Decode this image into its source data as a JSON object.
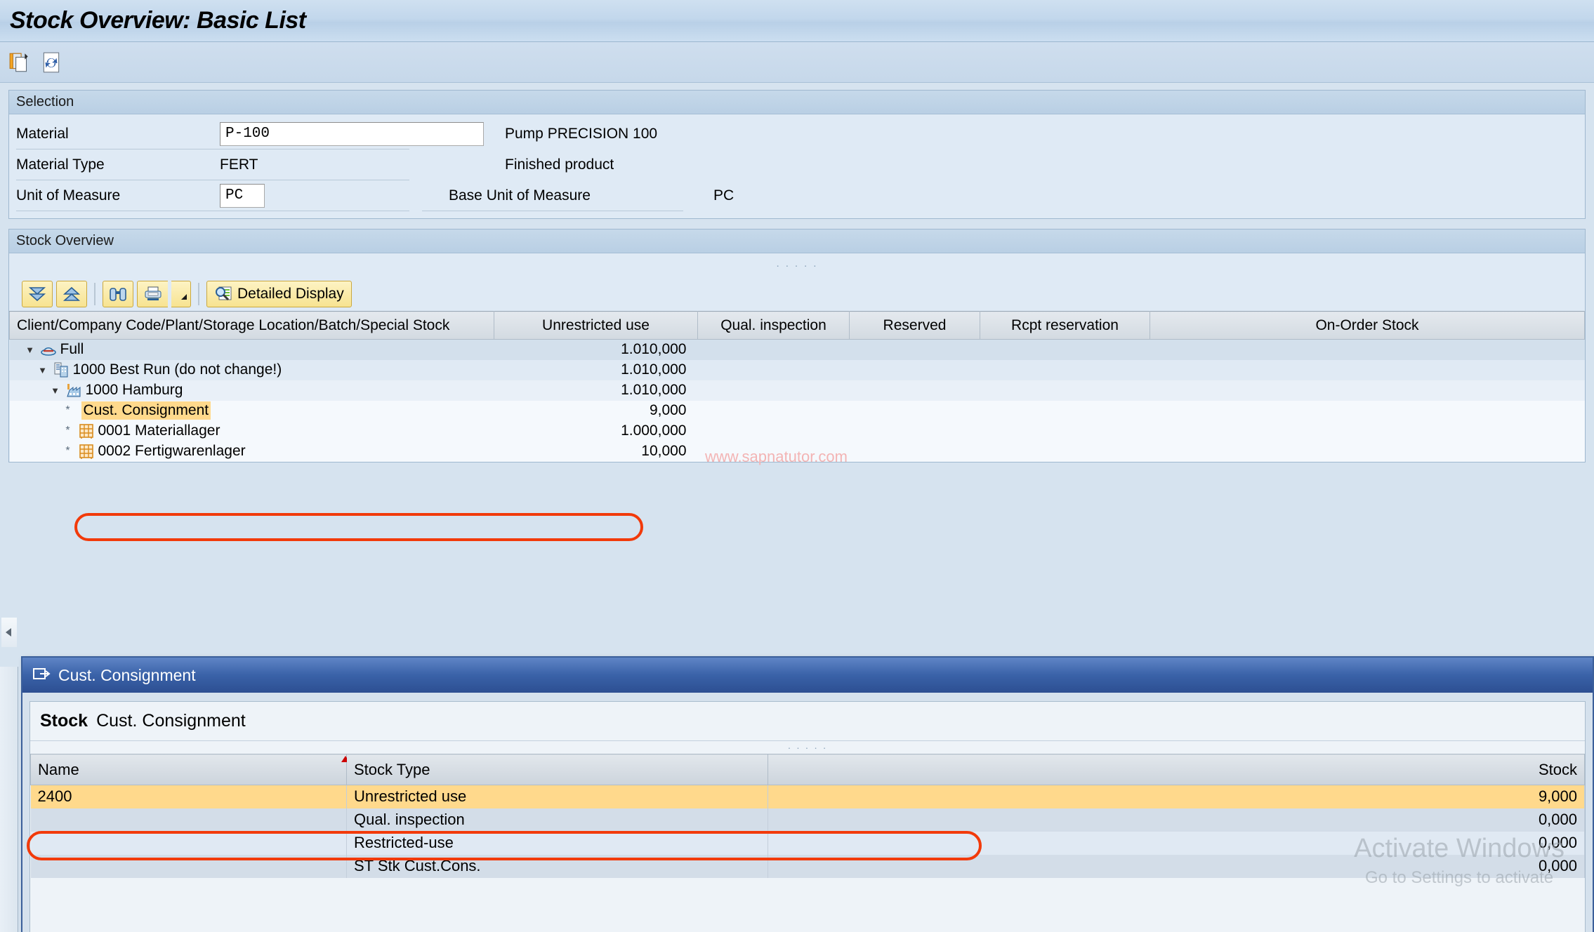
{
  "window": {
    "title": "Stock Overview: Basic List"
  },
  "main_toolbar": {
    "items": [
      {
        "name": "copy-icon",
        "tooltip": "Copy"
      },
      {
        "name": "refresh-icon",
        "tooltip": "Refresh"
      }
    ]
  },
  "selection": {
    "header": "Selection",
    "material_label": "Material",
    "material_value": "P-100",
    "material_desc": "Pump PRECISION 100",
    "material_type_label": "Material Type",
    "material_type_value": "FERT",
    "material_type_desc": "Finished product",
    "unit_label": "Unit of Measure",
    "unit_value": "PC",
    "base_unit_label": "Base Unit of Measure",
    "base_unit_value": "PC"
  },
  "stock_overview": {
    "header": "Stock Overview",
    "grip": "· · · · ·",
    "toolbar": {
      "expand_all": "expand-all-icon",
      "collapse_all": "collapse-all-icon",
      "find": "find-icon",
      "print": "print-icon",
      "print_menu": "chevron-down-icon",
      "detailed_display_label": "Detailed Display",
      "detailed_display_icon": "magnifier-list-icon"
    },
    "columns": [
      "Client/Company Code/Plant/Storage Location/Batch/Special Stock",
      "Unrestricted use",
      "Qual. inspection",
      "Reserved",
      "Rcpt reservation",
      "On-Order Stock"
    ],
    "watermark": "www.sapnatutor.com",
    "rows": [
      {
        "level": 0,
        "expander": "expanded",
        "icon": "client-hat-icon",
        "label": "Full",
        "unrestricted": "1.010,000",
        "highlight": false
      },
      {
        "level": 1,
        "expander": "expanded",
        "icon": "company-code-icon",
        "label": "1000 Best Run (do not change!)",
        "unrestricted": "1.010,000",
        "highlight": false
      },
      {
        "level": 2,
        "expander": "expanded",
        "icon": "plant-icon",
        "label": "1000 Hamburg",
        "unrestricted": "1.010,000",
        "highlight": false
      },
      {
        "level": 3,
        "expander": "leaf",
        "icon": "none",
        "label": "Cust. Consignment",
        "unrestricted": "9,000",
        "highlight": true
      },
      {
        "level": 3,
        "expander": "leaf",
        "icon": "storage-loc-icon",
        "label": "0001 Materiallager",
        "unrestricted": "1.000,000",
        "highlight": false
      },
      {
        "level": 3,
        "expander": "leaf",
        "icon": "storage-loc-icon",
        "label": "0002 Fertigwarenlager",
        "unrestricted": "10,000",
        "highlight": false
      }
    ]
  },
  "modal": {
    "title": "Cust. Consignment",
    "title_icon": "dialog-icon",
    "sub_strong": "Stock",
    "sub_light": "Cust. Consignment",
    "grip": "· · · · ·",
    "columns": [
      "Name",
      "Stock Type",
      "Stock"
    ],
    "rows": [
      {
        "name": "2400",
        "stock_type": "Unrestricted use",
        "stock": "9,000",
        "selected": true
      },
      {
        "name": "",
        "stock_type": "Qual. inspection",
        "stock": "0,000",
        "selected": false
      },
      {
        "name": "",
        "stock_type": "Restricted-use",
        "stock": "0,000",
        "selected": false
      },
      {
        "name": "",
        "stock_type": "ST Stk Cust.Cons.",
        "stock": "0,000",
        "selected": false
      }
    ]
  },
  "os_watermark": {
    "line1": "Activate Windows",
    "line2": "Go to Settings to activate"
  }
}
